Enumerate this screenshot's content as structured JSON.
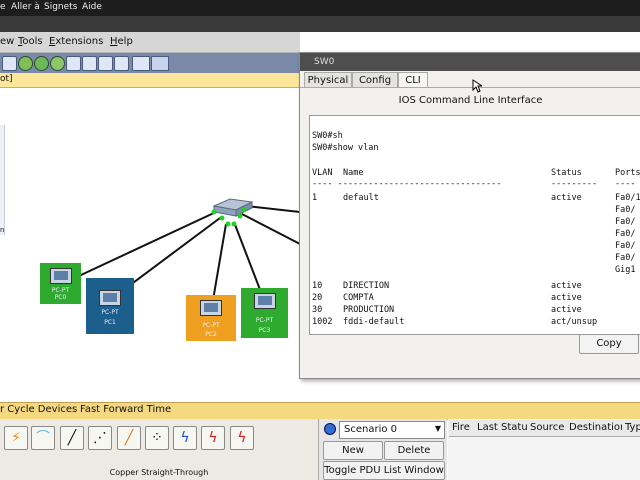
{
  "system_menu": [
    "e",
    "Aller à",
    "Signets",
    "Aide"
  ],
  "app_menu": [
    {
      "label": "ew",
      "underline": ""
    },
    {
      "label": "ools",
      "underline": "T"
    },
    {
      "label": "xtensions",
      "underline": "E"
    },
    {
      "label": "elp",
      "underline": "H"
    }
  ],
  "path_bar": "ot]",
  "left_marker": "n",
  "devices": {
    "pc0": {
      "label_model": "PC-PT",
      "label_name": "PC0",
      "color": "#2eab2e"
    },
    "pc1": {
      "label_model": "PC-PT",
      "label_name": "PC1",
      "color": "#1c5f8c"
    },
    "pc2": {
      "label_model": "PC-PT",
      "label_name": "PC2",
      "color": "#f0a020"
    },
    "pc3": {
      "label_model": "PC-PT",
      "label_name": "PC3",
      "color": "#2eab2e"
    }
  },
  "sw_window": {
    "title": "SW0",
    "tabs": [
      "Physical",
      "Config",
      "CLI"
    ],
    "active_tab": "CLI",
    "heading": "IOS Command Line Interface",
    "copy_label": "Copy",
    "terminal": {
      "prompt_lines": [
        "SW0#sh",
        "SW0#show vlan"
      ],
      "header": {
        "vlan": "VLAN",
        "name": "Name",
        "status": "Status",
        "ports": "Ports"
      },
      "separator_left": "---- --------------------------------",
      "separator_mid": "---------",
      "separator_right": "----",
      "rows": [
        {
          "vlan": "1",
          "name": "default",
          "status": "active",
          "ports": [
            "Fa0/1",
            "Fa0/",
            "Fa0/",
            "Fa0/",
            "Fa0/",
            "Fa0/",
            "Gig1"
          ]
        },
        {
          "vlan": "10",
          "name": "DIRECTION",
          "status": "active",
          "ports": []
        },
        {
          "vlan": "20",
          "name": "COMPTA",
          "status": "active",
          "ports": []
        },
        {
          "vlan": "30",
          "name": "PRODUCTION",
          "status": "active",
          "ports": []
        },
        {
          "vlan": "1002",
          "name": "fddi-default",
          "status": "act/unsup",
          "ports": []
        }
      ]
    }
  },
  "bottom_bar": {
    "cycle_label": "r Cycle Devices",
    "fast_forward_label": "Fast Forward Time"
  },
  "cable_label": "Copper Straight-Through",
  "scenario": {
    "select_value": "Scenario 0",
    "new_label": "New",
    "delete_label": "Delete",
    "toggle_label": "Toggle PDU List Window"
  },
  "pdu_columns": [
    "Fire",
    "Last Status",
    "Source",
    "Destination",
    "Typ"
  ],
  "colors": {
    "link": "#111111",
    "port_up": "#1fd41f",
    "accent_yellow": "#f5d980"
  }
}
